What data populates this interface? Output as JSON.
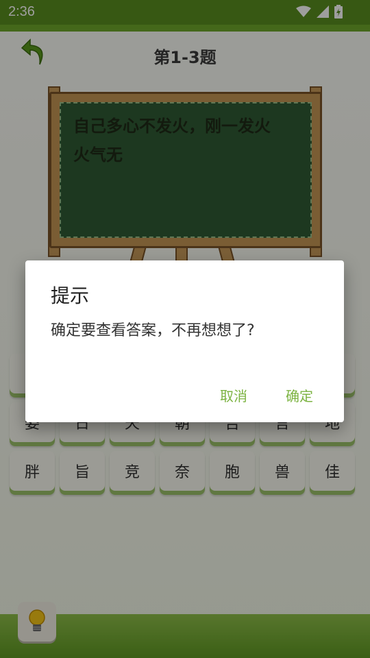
{
  "status_bar": {
    "time": "2:36",
    "icons": [
      "wifi-icon",
      "cell-signal-icon",
      "battery-charging-icon"
    ]
  },
  "header": {
    "title": "第1-3题",
    "back_icon": "undo-arrow-icon"
  },
  "board": {
    "line1": "自己多心不发火，刚一发火",
    "line2": "火气无"
  },
  "keys": {
    "row1": [
      "",
      "",
      "",
      "",
      "",
      "",
      ""
    ],
    "row2": [
      "姿",
      "日",
      "天",
      "朝",
      "吉",
      "言",
      "地"
    ],
    "row3": [
      "胖",
      "旨",
      "竞",
      "奈",
      "胞",
      "兽",
      "佳"
    ]
  },
  "hint_icon": "lightbulb-icon",
  "dialog": {
    "title": "提示",
    "message": "确定要查看答案，不再想想了?",
    "cancel_label": "取消",
    "confirm_label": "确定",
    "accent": "#7cb342"
  },
  "colors": {
    "status_bar": "#5a8f1f",
    "board": "#2f5b34",
    "wood": "#c69654"
  }
}
